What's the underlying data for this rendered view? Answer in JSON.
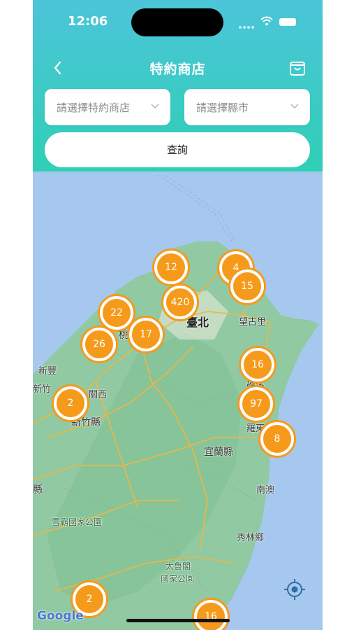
{
  "status_bar": {
    "time": "12:06"
  },
  "nav": {
    "title": "特約商店"
  },
  "filters": {
    "store_placeholder": "請選擇特約商店",
    "county_placeholder": "請選擇縣市",
    "query_label": "查詢"
  },
  "map": {
    "labels": {
      "taipei": "臺北",
      "taoyuan": "桃園",
      "xinfeng": "新豐",
      "xinzhu": "新竹",
      "guanxi": "關西",
      "hsinchu_county": "新竹縣",
      "county_left": "縣",
      "wanggu": "望古里",
      "jiaoxi": "礁溪",
      "luodong": "羅東",
      "yilan_county": "宜蘭縣",
      "nanao": "南澳",
      "shei_pa": "雪霸國家公園",
      "xiulin": "秀林鄉",
      "taroko_1": "太魯閣",
      "taroko_2": "國家公園"
    },
    "clusters": [
      {
        "id": "c1",
        "count": "12"
      },
      {
        "id": "c2",
        "count": "4"
      },
      {
        "id": "c3",
        "count": "15"
      },
      {
        "id": "c4",
        "count": "22"
      },
      {
        "id": "c5",
        "count": "420"
      },
      {
        "id": "c6",
        "count": "17"
      },
      {
        "id": "c7",
        "count": "26"
      },
      {
        "id": "c8",
        "count": "16"
      },
      {
        "id": "c9",
        "count": "2"
      },
      {
        "id": "c10",
        "count": "97"
      },
      {
        "id": "c11",
        "count": "8"
      },
      {
        "id": "c12",
        "count": "2"
      },
      {
        "id": "c13",
        "count": "16"
      }
    ],
    "attribution": "Google"
  },
  "colors": {
    "header_top": "#4cc5d9",
    "header_bottom": "#2fcfb5",
    "cluster": "#f59a1b",
    "sea": "#a6c8ee",
    "land": "#8fc9a0"
  },
  "icons": {
    "back": "chevron-left-icon",
    "cart": "shopping-bag-icon",
    "locate": "locate-crosshair-icon"
  }
}
